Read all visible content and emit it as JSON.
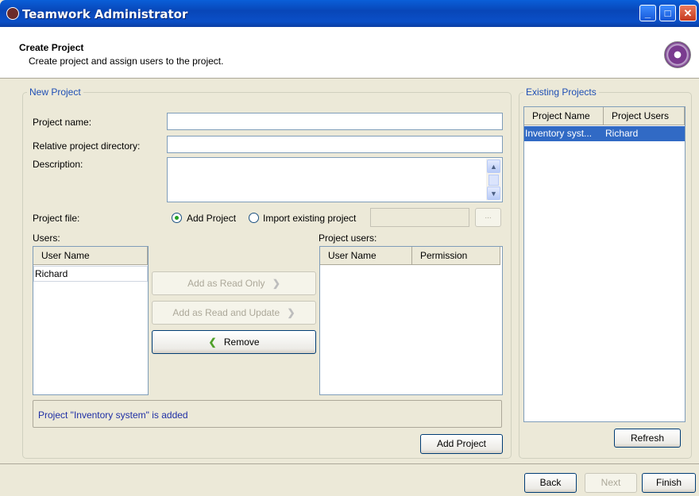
{
  "window": {
    "title": "Teamwork Administrator"
  },
  "header": {
    "title": "Create Project",
    "subtitle": "Create project and assign users to the project."
  },
  "new_project": {
    "legend": "New Project",
    "project_name_label": "Project name:",
    "project_name_value": "",
    "relative_dir_label": "Relative project directory:",
    "relative_dir_value": "",
    "description_label": "Description:",
    "description_value": "",
    "project_file_label": "Project file:",
    "radio_add": "Add Project",
    "radio_import": "Import existing project",
    "browse_label": "...",
    "users_label": "Users:",
    "users_header": "User Name",
    "users": [
      "Richard"
    ],
    "project_users_label": "Project users:",
    "project_users_headers": [
      "User Name",
      "Permission"
    ],
    "btn_read_only": "Add as Read Only",
    "btn_read_update": "Add as Read and Update",
    "btn_remove": "Remove",
    "status_message": "Project \"Inventory system\" is added",
    "btn_add_project": "Add Project"
  },
  "existing": {
    "legend": "Existing Projects",
    "headers": [
      "Project Name",
      "Project Users"
    ],
    "rows": [
      {
        "name": "Inventory syst...",
        "users": "Richard"
      }
    ],
    "btn_refresh": "Refresh"
  },
  "footer": {
    "back": "Back",
    "next": "Next",
    "finish": "Finish"
  },
  "colors": {
    "accent": "#316ac5",
    "legend": "#1f4fb5",
    "status_text": "#1f2fa5"
  }
}
